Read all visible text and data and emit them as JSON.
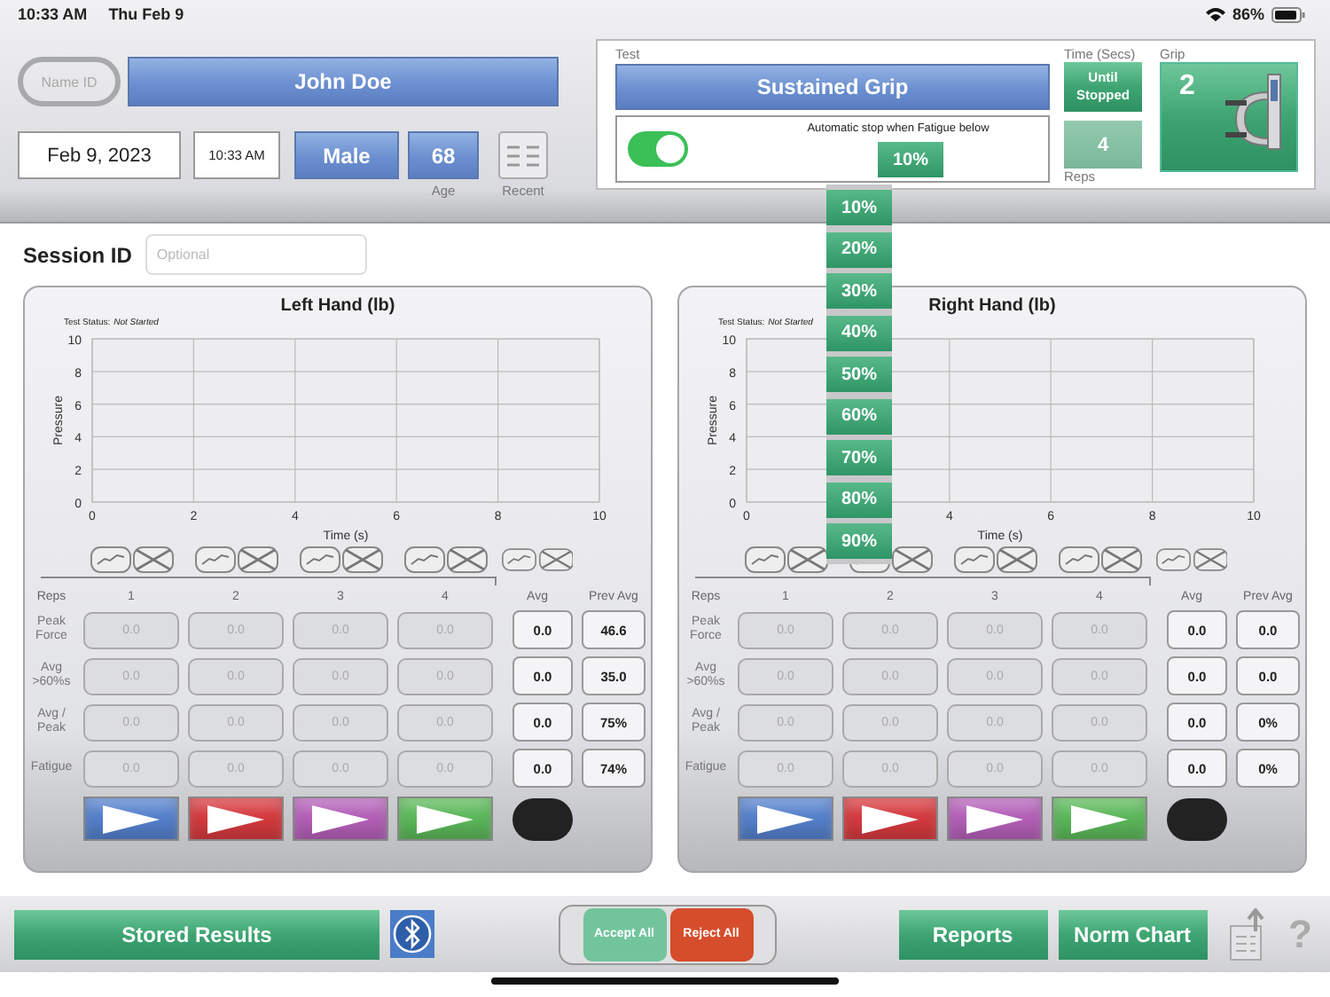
{
  "status_bar": {
    "time": "10:33 AM",
    "date": "Thu Feb 9",
    "battery": "86%"
  },
  "patient": {
    "name_id": "Name ID",
    "name": "John Doe",
    "date": "Feb 9, 2023",
    "time": "10:33 AM",
    "sex": "Male",
    "age": "68",
    "age_label": "Age",
    "recent_label": "Recent"
  },
  "test": {
    "label": "Test",
    "name": "Sustained Grip",
    "auto_stop": {
      "on": true,
      "label": "Automatic stop when Fatigue below",
      "value": "10%"
    },
    "time_label": "Time (Secs)",
    "time_value": "Until Stopped",
    "reps": "4",
    "reps_label": "Reps",
    "grip_label": "Grip",
    "grip": "2"
  },
  "fatigue_dropdown": [
    "10%",
    "20%",
    "30%",
    "40%",
    "50%",
    "60%",
    "70%",
    "80%",
    "90%"
  ],
  "session": {
    "label": "Session ID",
    "placeholder": "Optional"
  },
  "hands": [
    {
      "title": "Left Hand (lb)",
      "status_label": "Test Status:",
      "status": "Not Started",
      "chart_data": {
        "type": "line",
        "grid": true,
        "xlabel": "Time (s)",
        "ylabel": "Pressure",
        "xlim": [
          0,
          10
        ],
        "ylim": [
          0,
          10
        ],
        "xticks": [
          0,
          2,
          4,
          6,
          8,
          10
        ],
        "yticks": [
          0,
          2,
          4,
          6,
          8,
          10
        ]
      },
      "columns": [
        "Reps",
        "1",
        "2",
        "3",
        "4",
        "Avg",
        "Prev Avg"
      ],
      "rows": [
        {
          "label": "Peak Force",
          "reps": [
            "0.0",
            "0.0",
            "0.0",
            "0.0"
          ],
          "avg": "0.0",
          "prev_avg": "46.6"
        },
        {
          "label": "Avg >60%s",
          "reps": [
            "0.0",
            "0.0",
            "0.0",
            "0.0"
          ],
          "avg": "0.0",
          "prev_avg": "35.0"
        },
        {
          "label": "Avg / Peak",
          "reps": [
            "0.0",
            "0.0",
            "0.0",
            "0.0"
          ],
          "avg": "0.0",
          "prev_avg": "75%"
        },
        {
          "label": "Fatigue",
          "reps": [
            "0.0",
            "0.0",
            "0.0",
            "0.0"
          ],
          "avg": "0.0",
          "prev_avg": "74%"
        }
      ],
      "play_buttons": [
        {
          "color": "#5580cc"
        },
        {
          "color": "#d53a3e"
        },
        {
          "color": "#b460b8"
        },
        {
          "color": "#5cb85a"
        }
      ]
    },
    {
      "title": "Right Hand (lb)",
      "status_label": "Test Status:",
      "status": "Not Started",
      "chart_data": {
        "type": "line",
        "grid": true,
        "xlabel": "Time (s)",
        "ylabel": "Pressure",
        "xlim": [
          0,
          10
        ],
        "ylim": [
          0,
          10
        ],
        "xticks": [
          0,
          4,
          6,
          8,
          10
        ],
        "yticks": [
          0,
          2,
          4,
          6,
          8,
          10
        ]
      },
      "columns": [
        "Reps",
        "1",
        "2",
        "3",
        "4",
        "Avg",
        "Prev Avg"
      ],
      "rows": [
        {
          "label": "Peak Force",
          "reps": [
            "0.0",
            "0.0",
            "0.0",
            "0.0"
          ],
          "avg": "0.0",
          "prev_avg": "0.0"
        },
        {
          "label": "Avg >60%s",
          "reps": [
            "0.0",
            "0.0",
            "0.0",
            "0.0"
          ],
          "avg": "0.0",
          "prev_avg": "0.0"
        },
        {
          "label": "Avg / Peak",
          "reps": [
            "0.0",
            "0.0",
            "0.0",
            "0.0"
          ],
          "avg": "0.0",
          "prev_avg": "0%"
        },
        {
          "label": "Fatigue",
          "reps": [
            "0.0",
            "0.0",
            "0.0",
            "0.0"
          ],
          "avg": "0.0",
          "prev_avg": "0%"
        }
      ],
      "play_buttons": [
        {
          "color": "#5580cc"
        },
        {
          "color": "#d53a3e"
        },
        {
          "color": "#b460b8"
        },
        {
          "color": "#5cb85a"
        }
      ]
    }
  ],
  "bottom_bar": {
    "stored_results": "Stored Results",
    "accept_all": "Accept All",
    "reject_all": "Reject All",
    "reports": "Reports",
    "norm_chart": "Norm Chart",
    "help": "?"
  }
}
